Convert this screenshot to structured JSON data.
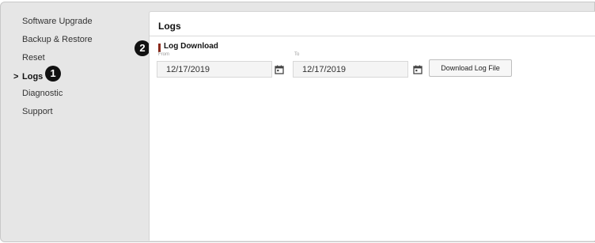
{
  "sidebar": {
    "items": [
      {
        "label": "Software Upgrade"
      },
      {
        "label": "Backup & Restore"
      },
      {
        "label": "Reset"
      },
      {
        "label": "Logs"
      },
      {
        "label": "Diagnostic"
      },
      {
        "label": "Support"
      }
    ],
    "active_indicator": ">"
  },
  "callouts": {
    "first": "1",
    "second": "2"
  },
  "panel": {
    "title": "Logs",
    "section_title": "Log Download",
    "from_label": "From",
    "from_value": "12/17/2019",
    "to_label": "To",
    "to_value": "12/17/2019",
    "download_button": "Download Log File"
  },
  "colors": {
    "accent_bar": "#8a2a1b",
    "callout_bg": "#111111"
  },
  "icons": {
    "calendar": "calendar-icon",
    "chevron": "chevron-right-icon"
  }
}
